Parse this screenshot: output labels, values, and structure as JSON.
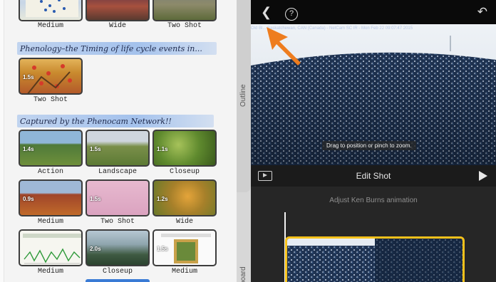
{
  "storyboard": {
    "top_row": [
      {
        "label": "Medium"
      },
      {
        "label": "Wide"
      },
      {
        "label": "Two Shot"
      }
    ],
    "section1": {
      "title": "Phenology–the Timing of life cycle events in...",
      "tiles": [
        {
          "label": "Two Shot",
          "duration": "1.5s"
        }
      ]
    },
    "section2": {
      "title": "Captured by the Phenocam Network!!",
      "rows": [
        [
          {
            "label": "Action",
            "duration": "1.4s"
          },
          {
            "label": "Landscape",
            "duration": "1.5s"
          },
          {
            "label": "Closeup",
            "duration": "1.1s"
          }
        ],
        [
          {
            "label": "Medium",
            "duration": "0.9s"
          },
          {
            "label": "Two Shot",
            "duration": "1.5s"
          },
          {
            "label": "Wide",
            "duration": "1.2s"
          }
        ],
        [
          {
            "label": "Medium",
            "duration": ""
          },
          {
            "label": "Closeup",
            "duration": "2.0s"
          },
          {
            "label": "Medium",
            "duration": "1.5s"
          }
        ]
      ]
    }
  },
  "side_tabs": {
    "outline": "Outline",
    "storyboard_partial": "board"
  },
  "editor": {
    "back_icon": "chevron-left-icon",
    "help_icon": "question-circle-icon",
    "undo_icon": "undo-icon",
    "help_symbol": "?",
    "info_line": "Old Bl... Saskatchewan, CAN (Canada) - NetCam SC IR - Mon Feb 22 09:07:47 2015",
    "drag_hint": "Drag to position or pinch to zoom.",
    "edit_title": "Edit Shot",
    "ken_burns_label": "Adjust Ken Burns animation"
  },
  "colors": {
    "accent_yellow": "#f5c11b",
    "annotation_arrow": "#ee7d1f",
    "title_highlight": "#9db9eb"
  }
}
